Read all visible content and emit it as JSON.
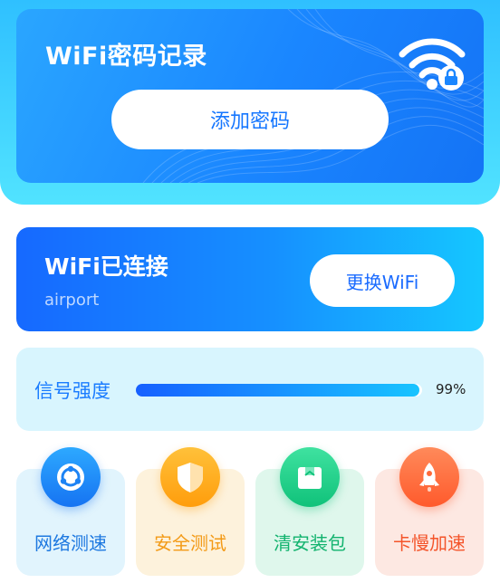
{
  "hero": {
    "title": "WiFi密码记录",
    "add_button_label": "添加密码",
    "icon": "wifi-lock-icon"
  },
  "connection": {
    "title": "WiFi已连接",
    "ssid": "airport",
    "switch_button_label": "更换WiFi"
  },
  "signal": {
    "label": "信号强度",
    "percent_text": "99%",
    "value": 0.99
  },
  "tools": [
    {
      "label": "网络测速",
      "icon": "speed-test-icon",
      "color": "#1d78e0"
    },
    {
      "label": "安全测试",
      "icon": "shield-icon",
      "color": "#f39a16"
    },
    {
      "label": "清安装包",
      "icon": "package-icon",
      "color": "#12b36e"
    },
    {
      "label": "卡慢加速",
      "icon": "rocket-icon",
      "color": "#f4542a"
    }
  ]
}
